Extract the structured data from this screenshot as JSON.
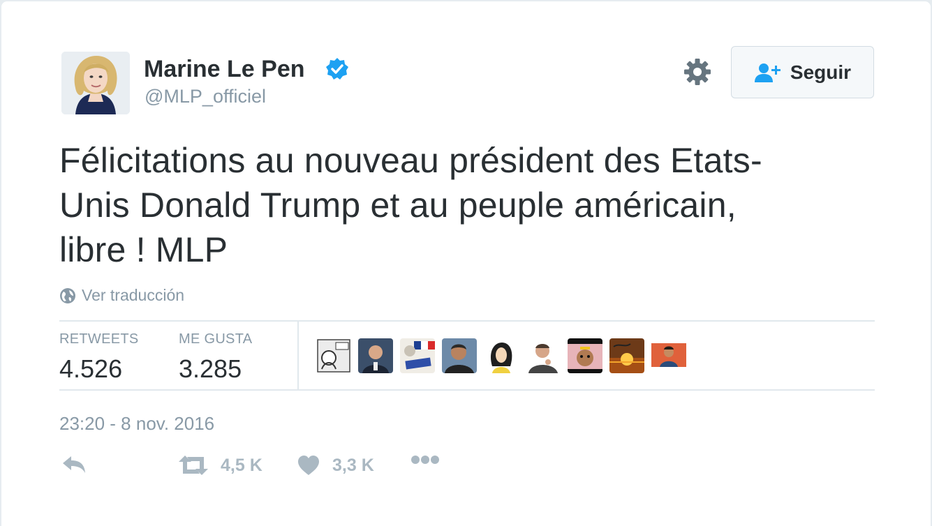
{
  "author": {
    "display_name": "Marine Le Pen",
    "handle": "@MLP_officiel",
    "verified": true
  },
  "follow_button": {
    "label": "Seguir"
  },
  "tweet": {
    "lines": [
      "Félicitations au nouveau président des Etats-",
      "Unis Donald Trump et au peuple américain,",
      "libre ! MLP"
    ],
    "translate_label": "Ver traducción"
  },
  "stats": {
    "retweets_label": "RETWEETS",
    "retweets_value": "4.526",
    "likes_label": "ME GUSTA",
    "likes_value": "3.285",
    "liker_avatars": [
      "avatar-1",
      "avatar-2",
      "avatar-3",
      "avatar-4",
      "avatar-5",
      "avatar-6",
      "avatar-7",
      "avatar-8",
      "avatar-9"
    ]
  },
  "timestamp": "23:20 - 8 nov. 2016",
  "actions": {
    "reply_icon": "reply-icon",
    "retweet_count": "4,5 K",
    "like_count": "3,3 K",
    "more_icon": "more-icon"
  },
  "colors": {
    "text": "#292f33",
    "muted": "#8899a6",
    "verified": "#1da1f2",
    "action_icons": "#aab8c2"
  }
}
